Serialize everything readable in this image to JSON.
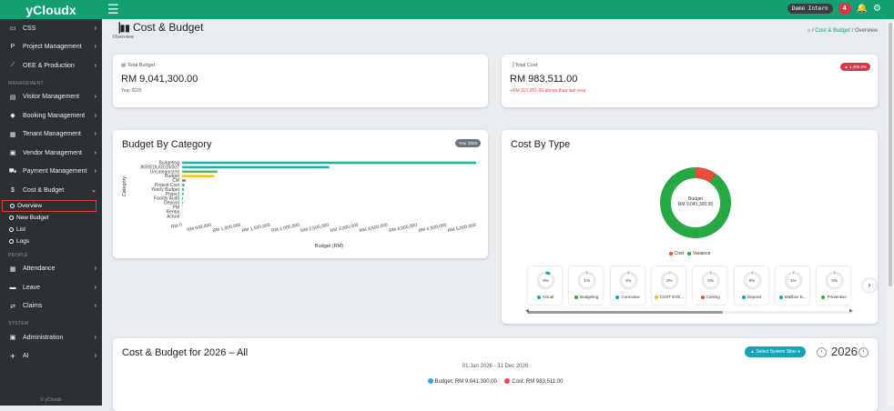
{
  "topbar": {
    "brand": "yCloudx",
    "demo_badge": "Demo Intern",
    "notification_count": "4"
  },
  "sidebar": {
    "items": [
      {
        "icon": "monitor-icon",
        "label": "CSS"
      },
      {
        "icon": "project-icon",
        "label": "Project Management"
      },
      {
        "icon": "chart-line-icon",
        "label": "OEE & Production"
      }
    ],
    "section_management": "MANAGEMENT",
    "management_items": [
      {
        "icon": "id-card-icon",
        "label": "Visitor Management"
      },
      {
        "icon": "tag-icon",
        "label": "Booking Management"
      },
      {
        "icon": "building-icon",
        "label": "Tenant Management"
      },
      {
        "icon": "vendor-icon",
        "label": "Vendor Management"
      },
      {
        "icon": "cart-icon",
        "label": "Payment Management"
      },
      {
        "icon": "dollar-icon",
        "label": "Cost & Budget"
      }
    ],
    "cost_budget_sub": [
      "Overview",
      "New Budget",
      "List",
      "Logs"
    ],
    "section_people": "PEOPLE",
    "people_items": [
      {
        "icon": "calendar-icon",
        "label": "Attendance"
      },
      {
        "icon": "bed-icon",
        "label": "Leave"
      },
      {
        "icon": "exchange-icon",
        "label": "Claims"
      }
    ],
    "section_system": "SYSTEM",
    "system_items": [
      {
        "icon": "admin-icon",
        "label": "Administration"
      },
      {
        "icon": "plane-icon",
        "label": "AI"
      }
    ],
    "footer": "© yCloudx"
  },
  "page": {
    "title": "Cost & Budget",
    "subtitle": "Overview",
    "breadcrumb": [
      "Cost & Budget",
      "Overview"
    ]
  },
  "kpi": {
    "budget": {
      "label": "Total Budget",
      "value": "RM 9,041,300.00",
      "sub": "Year 2026"
    },
    "cost": {
      "label": "Total Cost",
      "value": "RM 983,511.00",
      "sub": "+RM 921,851.00 above than last year",
      "badge": "1,495.5%"
    }
  },
  "budget_by_category": {
    "title": "Budget By Category",
    "year_pill": "Year 2026",
    "ylabel": "Category",
    "xlabel": "Budget (RM)",
    "colors": {
      "budget": "#20b2aa",
      "green": "#5cb85c",
      "yellow": "#f0c419",
      "red": "#e74c3c"
    }
  },
  "chart_data": {
    "type": "bar",
    "orientation": "horizontal",
    "categories": [
      "Budgeting",
      "JKR/EDU/2019/007",
      "Uncategorized",
      "Budget",
      "CM",
      "Project Cost",
      "Yearly Budget",
      "Project",
      "Facility Audit",
      "Deposit",
      "PM",
      "Rental",
      "Actual"
    ],
    "values": [
      5000000,
      2500000,
      600000,
      550000,
      60000,
      40000,
      30000,
      25000,
      15000,
      10000,
      0,
      0,
      0
    ],
    "bar_colors": [
      "#20b2aa",
      "#20b2aa",
      "#5cb85c",
      "#f0c419",
      "#e74c3c",
      "#20b2aa",
      "#20b2aa",
      "#20b2aa",
      "#20b2aa",
      "#20b2aa",
      "#20b2aa",
      "#20b2aa",
      "#20b2aa"
    ],
    "xticks": [
      "RM 0",
      "RM 500,000",
      "RM 1,000,000",
      "RM 1,500,000",
      "RM 2,000,000",
      "RM 2,500,000",
      "RM 3,000,000",
      "RM 3,500,000",
      "RM 4,000,000",
      "RM 4,500,000",
      "RM 5,000,000"
    ],
    "xlim": [
      0,
      5000000
    ],
    "xlabel": "Budget (RM)",
    "ylabel": "Category",
    "title": "Budget By Category"
  },
  "cost_by_type": {
    "title": "Cost By Type",
    "donut_center_line1": "Budget",
    "donut_center_line2": "RM 9,041,300.00",
    "legend": [
      {
        "label": "Cost",
        "color": "#e74c3c"
      },
      {
        "label": "Variance",
        "color": "#28a745"
      }
    ],
    "cost_fraction": 0.098,
    "mini": [
      {
        "pct": "9%",
        "label": "Actual",
        "color": "#17a2b8"
      },
      {
        "pct": "1%",
        "label": "Budgeting",
        "color": "#28a745"
      },
      {
        "pct": "1%",
        "label": "Corrective",
        "color": "#17a2b8"
      },
      {
        "pct": "2%",
        "label": "COST EVE...",
        "color": "#f0c419"
      },
      {
        "pct": "0%",
        "label": "Costing",
        "color": "#e74c3c"
      },
      {
        "pct": "0%",
        "label": "Deposit",
        "color": "#17a2b8"
      },
      {
        "pct": "1%",
        "label": "Mailbox D...",
        "color": "#17a2b8"
      },
      {
        "pct": "0%",
        "label": "Preventive",
        "color": "#28a745"
      }
    ],
    "next": "›"
  },
  "yearly": {
    "title": "Cost & Budget for 2026 – All",
    "select_button": "Select System Sites",
    "year": "2026",
    "date_range": "01 Jan 2026 - 31 Dec 2026",
    "legend": [
      {
        "label": "Budget: RM 9,041,300.00",
        "color": "#36a2eb"
      },
      {
        "label": "Cost: RM 983,511.00",
        "color": "#ff3b5c"
      }
    ]
  }
}
